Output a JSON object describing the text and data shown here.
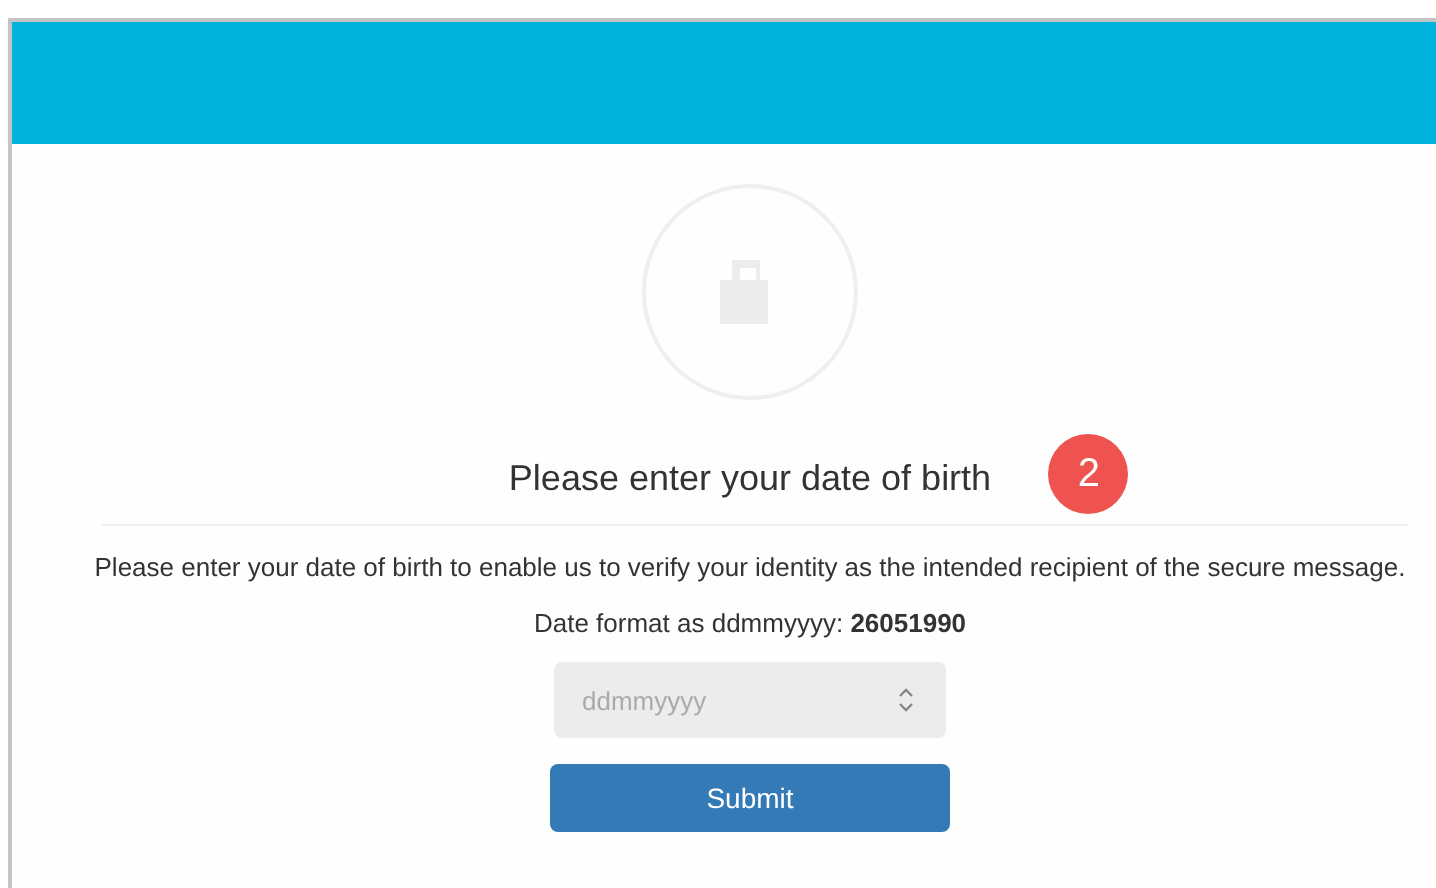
{
  "page": {
    "title": "Please enter your date of birth",
    "badge": "2",
    "description": "Please enter your date of birth to enable us to verify your identity as the intended recipient of the secure message.",
    "format_hint": "Date format as ddmmyyyy: **26051990**"
  },
  "form": {
    "date_field": {
      "placeholder": "ddmmyyyy"
    },
    "submit": "Submit"
  }
}
